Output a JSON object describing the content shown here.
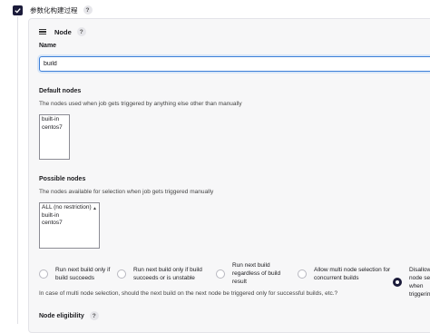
{
  "parameterized": {
    "label": "参数化构建过程",
    "help": "?"
  },
  "node_panel": {
    "title": "Node",
    "help": "?",
    "name_label": "Name",
    "name_value": "build",
    "default_nodes": {
      "label": "Default nodes",
      "description": "The nodes used when job gets triggered by anything else other than manually",
      "options": [
        "built-in",
        "centos7"
      ]
    },
    "possible_nodes": {
      "label": "Possible nodes",
      "description": "The nodes available for selection when job gets triggered manually",
      "options": [
        "ALL (no restriction)",
        "built-in",
        "centos7"
      ]
    },
    "trigger_options": [
      {
        "label": "Run next build only if build succeeds",
        "checked": false
      },
      {
        "label": "Run next build only if build succeeds or is unstable",
        "checked": false
      },
      {
        "label": "Run next build regardless of build result",
        "checked": false
      },
      {
        "label": "Allow multi node selection for concurrent builds",
        "checked": false
      },
      {
        "label": "Disallow multi node selection when triggering",
        "checked": true
      }
    ],
    "trigger_help_text": "In case of multi node selection, should the next build on the next node be triggered only for successful builds, etc.?",
    "eligibility_label": "Node eligibility",
    "eligibility_help": "?"
  }
}
